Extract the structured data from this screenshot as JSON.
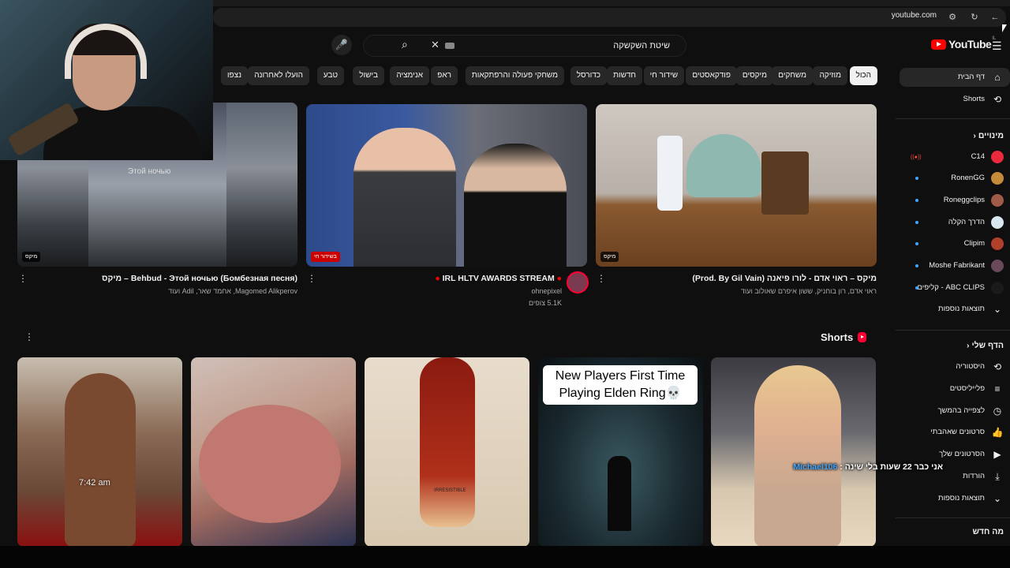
{
  "browser": {
    "url": "youtube.com"
  },
  "header": {
    "logo_text": "YouTube",
    "logo_region": "IL",
    "search_value": "שיטת השקשקה"
  },
  "chips": [
    "הכול",
    "מוזיקה",
    "משחקים",
    "מיקסים",
    "פודקאסטים",
    "שידור חי",
    "חדשות",
    "כדורסל",
    "משחקי פעולה והרפתקאות",
    "ראפ",
    "אנימציה",
    "בישול",
    "טבע",
    "הועלו לאחרונה",
    "נצפו"
  ],
  "videos": [
    {
      "title": "Behbud - Этой ночью (Бомбезная песня) – מיקס",
      "meta": "Magomed Alikperov, אחמד שאר, Adil ועוד",
      "badge": "מיקס",
      "thumb_text": "Этой ночью"
    },
    {
      "title": "IRL HLTV AWARDS STREAM",
      "channel": "ohnepixel",
      "views": "5.1K צופים",
      "badge": "בשידור חי"
    },
    {
      "title": "מיקס – ראוי אדם - לורו פיאנה (Prod. By Gil Vain)",
      "meta": "ראוי אדם, רון בוחניק, ששון איפרם שאולוב ועוד",
      "badge": "מיקס"
    }
  ],
  "shorts": {
    "heading": "Shorts",
    "items": [
      {
        "overlay": "7:42 am"
      },
      {},
      {
        "overlay": "IRRESISTIBLE"
      },
      {
        "caption": "New Players First Time Playing Elden Ring💀"
      },
      {}
    ]
  },
  "chat_overlay": {
    "name": "Michael106",
    "message": "אני כבר 22 שעות בלי שינה :"
  },
  "sidebar": {
    "home": "דף הבית",
    "shorts": "Shorts",
    "subs_heading": "מינויים",
    "subscriptions": [
      {
        "name": "C14",
        "live": true,
        "color": "#e8293e"
      },
      {
        "name": "RonenGG",
        "dot": true,
        "color": "#c58a3a"
      },
      {
        "name": "Roneggclips",
        "dot": true,
        "color": "#a05a48"
      },
      {
        "name": "הדרך הקלה",
        "dot": true,
        "color": "#d8e8f0"
      },
      {
        "name": "Clipim",
        "dot": true,
        "color": "#b0402a"
      },
      {
        "name": "Moshe Fabrikant",
        "dot": true,
        "color": "#6a4a5a"
      },
      {
        "name": "ABC CLIPS - קליפים",
        "dot": true,
        "color": "#1a1a1a"
      }
    ],
    "show_more": "תוצאות נוספות",
    "you_heading": "הדף שלי",
    "you_items": [
      "היסטוריה",
      "פלייליסטים",
      "לצפייה בהמשך",
      "סרטונים שאהבתי",
      "הסרטונים שלך",
      "הורדות"
    ],
    "you_icons": [
      "history-icon",
      "playlists-icon",
      "watch-later-icon",
      "liked-icon",
      "your-videos-icon",
      "downloads-icon"
    ],
    "show_more_2": "תוצאות נוספות",
    "explore_heading": "מה חדש"
  }
}
